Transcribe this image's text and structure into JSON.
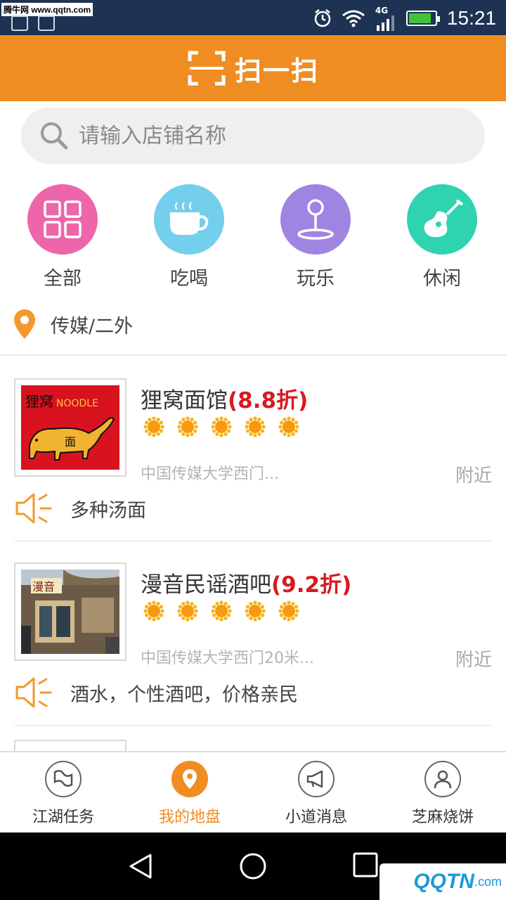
{
  "status_bar": {
    "watermark": "腾牛网 www.qqtn.com",
    "network": "4G",
    "time": "15:21",
    "battery_level": 0.85
  },
  "header": {
    "title": "扫一扫"
  },
  "search": {
    "placeholder": "请输入店铺名称"
  },
  "categories": [
    {
      "label": "全部",
      "icon": "grid-icon",
      "color": "#ec66a9"
    },
    {
      "label": "吃喝",
      "icon": "cup-icon",
      "color": "#74cfec"
    },
    {
      "label": "玩乐",
      "icon": "joystick-icon",
      "color": "#a084e2"
    },
    {
      "label": "休闲",
      "icon": "guitar-icon",
      "color": "#2fd3b0"
    }
  ],
  "location": {
    "label": "传媒/二外"
  },
  "shops": [
    {
      "name": "狸窝面馆",
      "discount": "(8.8折)",
      "rating": 5,
      "address": "中国传媒大学西门...",
      "distance": "附近",
      "promo": "多种汤面"
    },
    {
      "name": "漫音民谣酒吧",
      "discount": "(9.2折)",
      "rating": 5,
      "address": "中国传媒大学西门20米...",
      "distance": "附近",
      "promo": "酒水，个性酒吧，价格亲民"
    }
  ],
  "bottom_nav": [
    {
      "label": "江湖任务",
      "icon": "flag-icon",
      "active": false
    },
    {
      "label": "我的地盘",
      "icon": "location-pin-icon",
      "active": true
    },
    {
      "label": "小道消息",
      "icon": "megaphone-icon",
      "active": false
    },
    {
      "label": "芝麻烧饼",
      "icon": "user-icon",
      "active": false
    }
  ],
  "colors": {
    "accent": "#f08d22",
    "discount": "#d8191e",
    "statusbar": "#1e3354"
  },
  "corner_watermark": {
    "text": "QQTN",
    "suffix": ".com",
    "badge": "腾牛网"
  }
}
